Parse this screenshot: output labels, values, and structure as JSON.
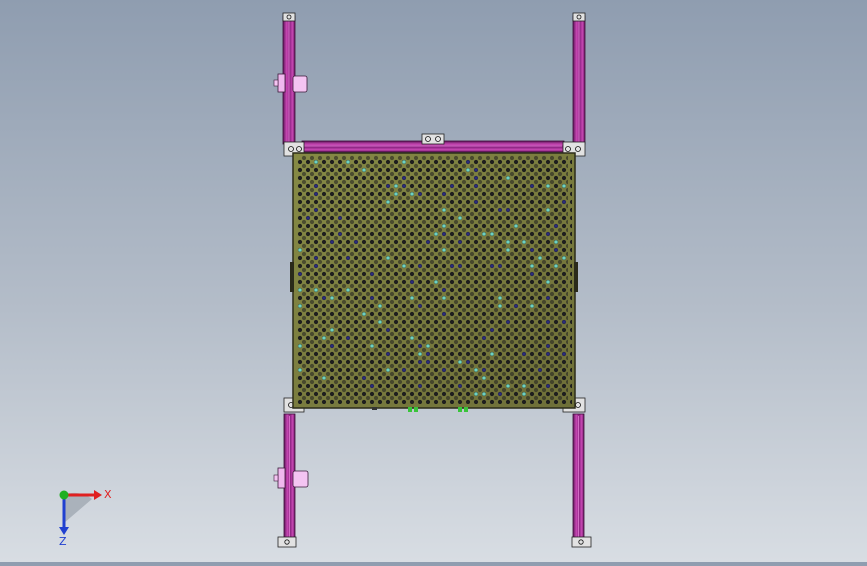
{
  "viewport": {
    "background_top": "#8f9db0",
    "background_bottom": "#d8dde3"
  },
  "colors": {
    "profile": "#b83aa6",
    "profile_dark": "#5e1459",
    "plate": "#7a7a3e",
    "plate_edge": "#2c2c1a",
    "hole": "#1c1c1c",
    "hole_blue": "#2b2c7a",
    "hole_teal": "#6fd3c0",
    "motor": "#f0b8ee",
    "bracket": "#d8d8d8",
    "x_axis": "#e02020",
    "y_axis": "#20b020",
    "z_axis": "#2040d0"
  },
  "triad": {
    "x_label": "X",
    "z_label": "Z",
    "x_icon": "x-axis-arrow-icon",
    "y_icon": "y-axis-dot-icon",
    "z_icon": "z-axis-arrow-icon"
  }
}
